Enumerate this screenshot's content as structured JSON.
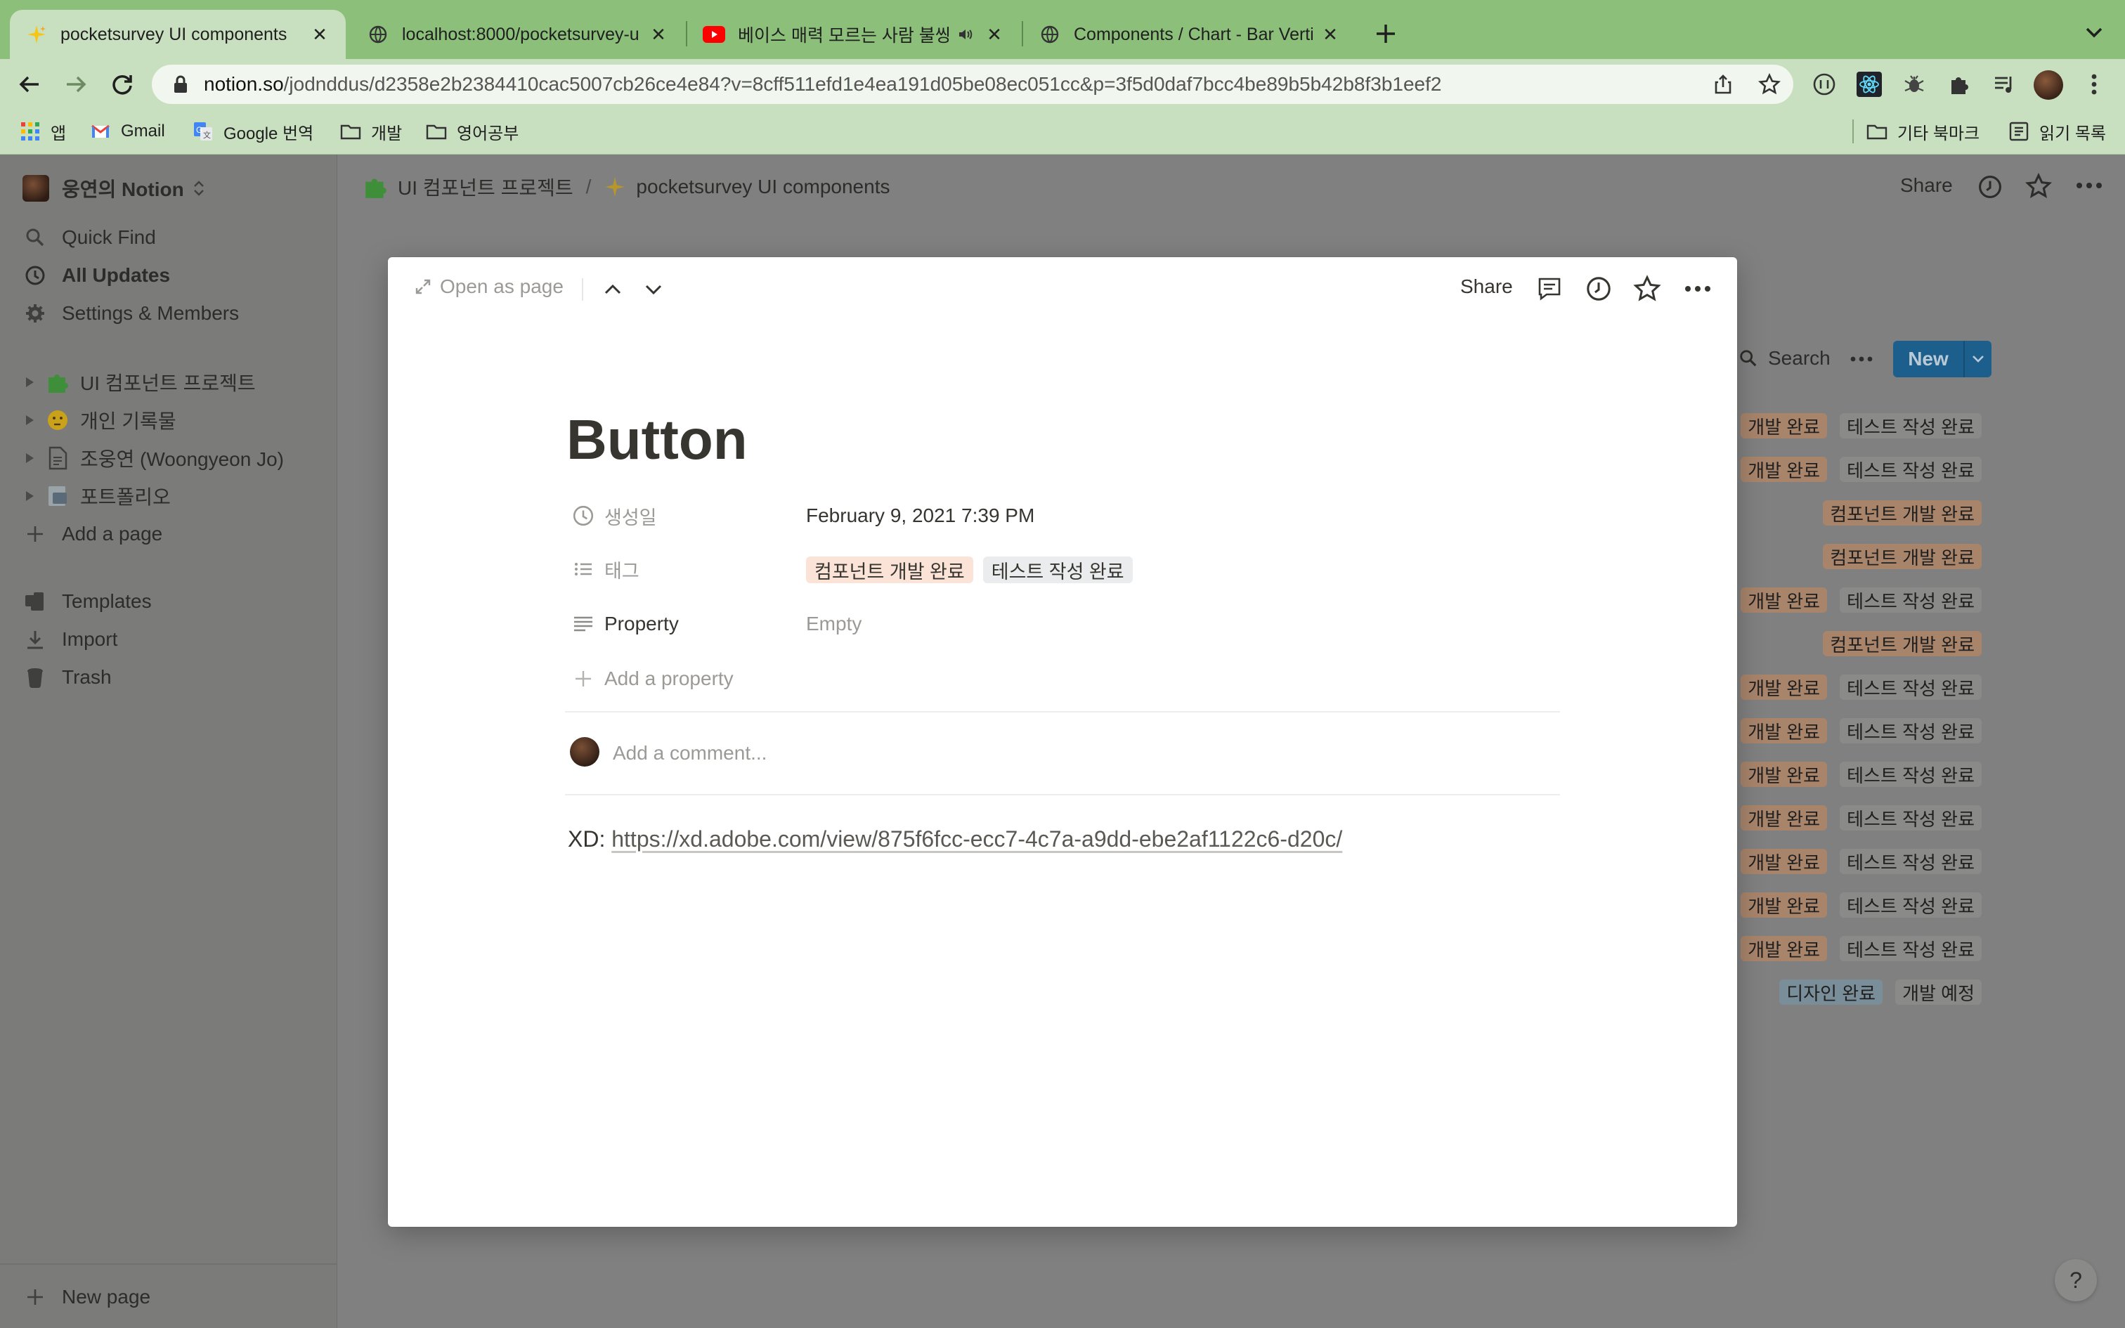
{
  "browser": {
    "tabs": [
      {
        "title": "pocketsurvey UI components",
        "favicon": "sparkles-icon",
        "active": true
      },
      {
        "title": "localhost:8000/pocketsurvey-u",
        "favicon": "globe-icon",
        "active": false
      },
      {
        "title": "베이스 매력 모르는 사람 불쌍해",
        "favicon": "youtube-icon",
        "active": false,
        "muted": true
      },
      {
        "title": "Components / Chart - Bar Verti",
        "favicon": "globe-icon",
        "active": false
      }
    ],
    "url_host": "notion.so",
    "url_path": "/jodnddus/d2358e2b2384410cac5007cb26ce4e84?v=8cff511efd1e4ea191d05be08ec051cc&p=3f5d0daf7bcc4be89b5b42b8f3b1eef2",
    "bookmarks": [
      {
        "label": "앱",
        "icon": "apps-grid-icon"
      },
      {
        "label": "Gmail",
        "icon": "gmail-icon"
      },
      {
        "label": "Google 번역",
        "icon": "translate-icon"
      },
      {
        "label": "개발",
        "icon": "folder-icon"
      },
      {
        "label": "영어공부",
        "icon": "folder-icon"
      }
    ],
    "bookmarks_right": [
      {
        "label": "기타 북마크",
        "icon": "folder-icon"
      },
      {
        "label": "읽기 목록",
        "icon": "reading-list-icon"
      }
    ],
    "accent": "#8bbf7a"
  },
  "sidebar": {
    "workspace": "웅연의 Notion",
    "nav": [
      {
        "label": "Quick Find",
        "icon": "search-icon"
      },
      {
        "label": "All Updates",
        "icon": "clock-icon"
      },
      {
        "label": "Settings & Members",
        "icon": "gear-icon"
      }
    ],
    "pages": [
      {
        "label": "UI 컴포넌트 프로젝트",
        "icon": "puzzle-icon"
      },
      {
        "label": "개인 기록물",
        "icon": "thinking-face-icon"
      },
      {
        "label": "조웅연 (Woongyeon Jo)",
        "icon": "page-icon"
      },
      {
        "label": "포트폴리오",
        "icon": "briefcase-page-icon"
      }
    ],
    "add_page": "Add a page",
    "tools": [
      {
        "label": "Templates",
        "icon": "templates-icon"
      },
      {
        "label": "Import",
        "icon": "download-icon"
      },
      {
        "label": "Trash",
        "icon": "trash-icon"
      }
    ],
    "new_page": "New page"
  },
  "topbar": {
    "breadcrumb": [
      "UI 컴포넌트 프로젝트",
      "pocketsurvey UI components"
    ],
    "breadcrumb_sep": "/",
    "share": "Share"
  },
  "database": {
    "search": "Search",
    "new": "New",
    "rows": [
      [
        "개발 완료",
        "테스트 작성 완료"
      ],
      [
        "개발 완료",
        "테스트 작성 완료"
      ],
      [
        "컴포넌트 개발 완료"
      ],
      [
        "컴포넌트 개발 완료"
      ],
      [
        "개발 완료",
        "테스트 작성 완료"
      ],
      [
        "컴포넌트 개발 완료"
      ],
      [
        "개발 완료",
        "테스트 작성 완료"
      ],
      [
        "개발 완료",
        "테스트 작성 완료"
      ],
      [
        "개발 완료",
        "테스트 작성 완료"
      ],
      [
        "개발 완료",
        "테스트 작성 완료"
      ],
      [
        "개발 완료",
        "테스트 작성 완료"
      ],
      [
        "개발 완료",
        "테스트 작성 완료"
      ],
      [
        "개발 완료",
        "테스트 작성 완료"
      ],
      [
        "디자인 완료",
        "개발 예정"
      ]
    ]
  },
  "modal": {
    "open_as_page": "Open as page",
    "share": "Share",
    "title": "Button",
    "properties": [
      {
        "icon": "clock-icon",
        "name": "생성일",
        "value": "February 9, 2021 7:39 PM"
      },
      {
        "icon": "list-icon",
        "name": "태그",
        "tags": [
          "컴포넌트 개발 완료",
          "테스트 작성 완료"
        ]
      },
      {
        "icon": "text-icon",
        "name": "Property",
        "value": "Empty"
      }
    ],
    "add_property": "Add a property",
    "comment_placeholder": "Add a comment...",
    "body_prefix": "XD: ",
    "body_link": "https://xd.adobe.com/view/875f6fcc-ecc7-4c7a-a9dd-ebe2af1122c6-d20c/"
  },
  "help": "?"
}
